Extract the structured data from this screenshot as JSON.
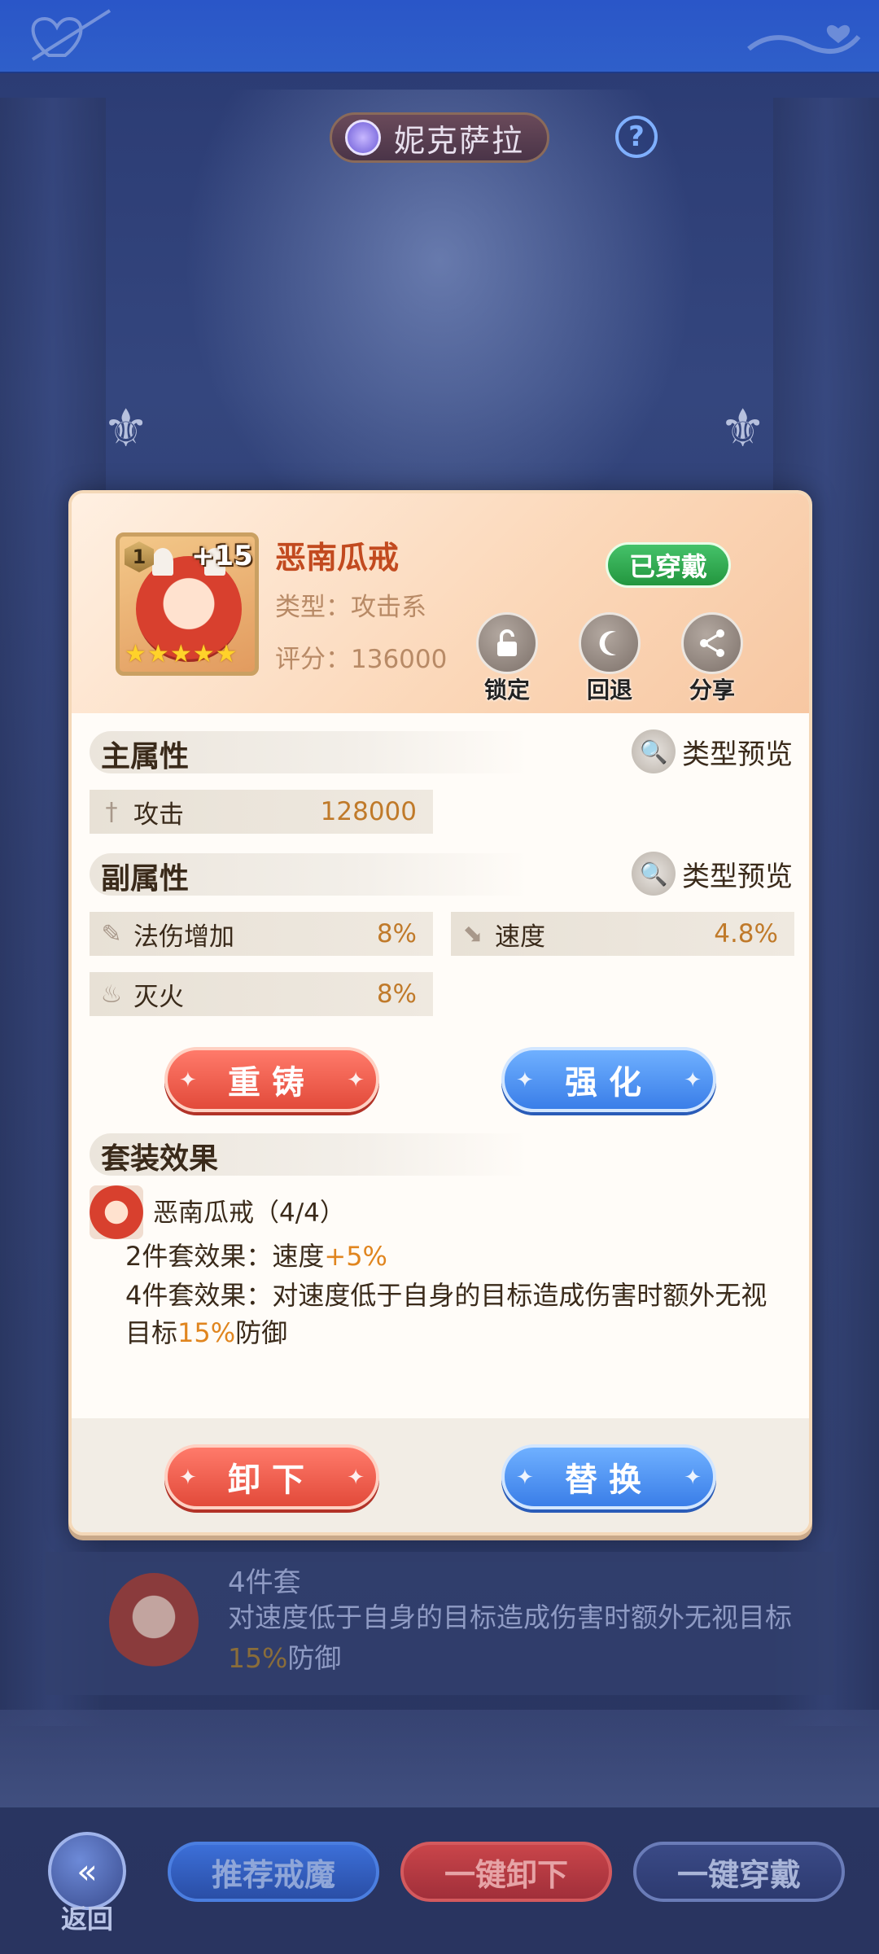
{
  "header": {
    "title": "妮克萨拉",
    "help_glyph": "?"
  },
  "equipment": {
    "name": "恶南瓜戒",
    "level_badge": "1",
    "enhance_level": "+15",
    "stars": 5,
    "type_line": "类型：攻击系",
    "score_line": "评分：136000",
    "status_badge": "已穿戴",
    "actions": [
      {
        "label": "锁定",
        "icon": "lock-icon"
      },
      {
        "label": "回退",
        "icon": "rewind-icon"
      },
      {
        "label": "分享",
        "icon": "share-icon"
      }
    ]
  },
  "main_attr": {
    "title": "主属性",
    "preview_label": "类型预览",
    "stat": {
      "name": "攻击",
      "value": "128000",
      "icon": "sword-icon"
    }
  },
  "sub_attr": {
    "title": "副属性",
    "preview_label": "类型预览",
    "stats": [
      {
        "name": "法伤增加",
        "value": "8%",
        "icon": "wand-icon"
      },
      {
        "name": "速度",
        "value": "4.8%",
        "icon": "boot-icon"
      },
      {
        "name": "灭火",
        "value": "8%",
        "icon": "flame-icon"
      }
    ]
  },
  "buttons": {
    "recast": "重铸",
    "enhance": "强化",
    "unequip": "卸下",
    "replace": "替换"
  },
  "set_effect": {
    "title": "套装效果",
    "set_name": "恶南瓜戒（4/4）",
    "two_piece_prefix": "2件套效果：速度",
    "two_piece_value": "+5%",
    "four_piece_prefix": "4件套效果：对速度低于自身的目标造成伤害时额外无视目标",
    "four_piece_value": "15%",
    "four_piece_suffix": "防御"
  },
  "background_panel": {
    "heading": "4件套",
    "desc_prefix": "对速度低于自身的目标造成伤害时额外无视目标",
    "desc_value": "15%",
    "desc_suffix": "防御"
  },
  "bottom_bar": {
    "back_label": "返回",
    "recommend": "推荐戒魔",
    "unequip_all": "一键卸下",
    "equip_all": "一键穿戴"
  },
  "colors": {
    "equipped_green": "#23963e",
    "red_button": "#e24a3a",
    "blue_button": "#3a7ee8",
    "highlight": "#e0851f"
  }
}
